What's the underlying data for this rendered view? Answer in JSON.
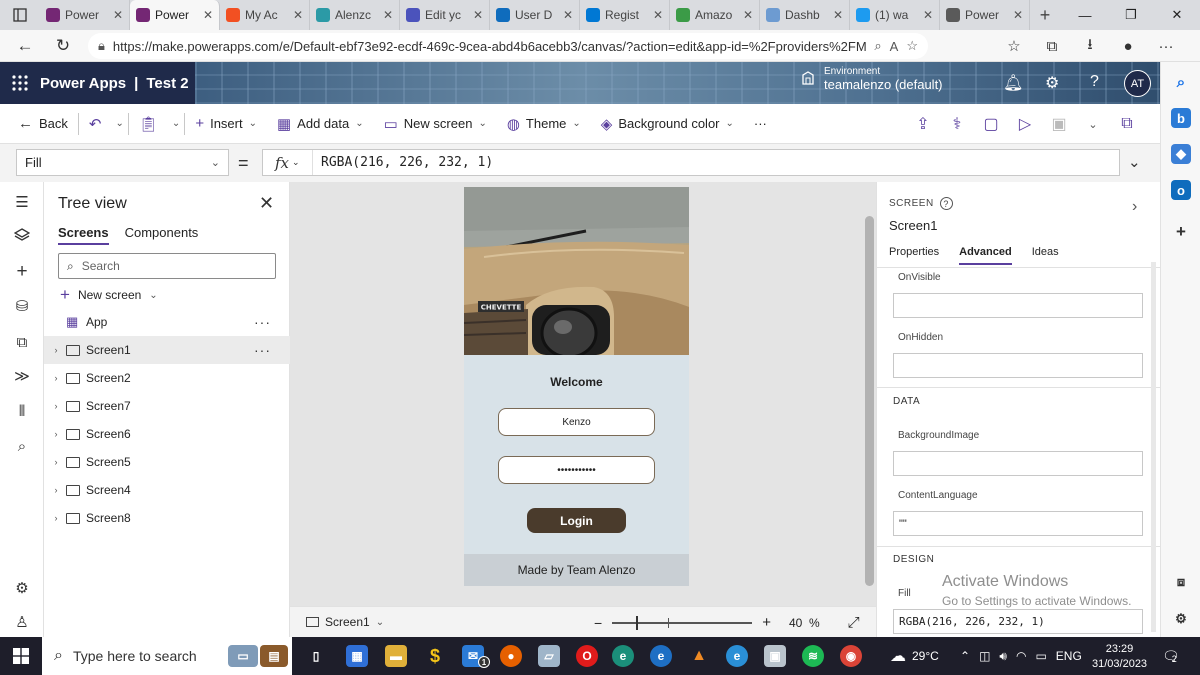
{
  "browser": {
    "tabs": [
      {
        "title": "Power",
        "color": "#742774"
      },
      {
        "title": "Power",
        "color": "#742774",
        "active": true
      },
      {
        "title": "My Ac",
        "color": "#f25022"
      },
      {
        "title": "Alenzc",
        "color": "#2b9aa6"
      },
      {
        "title": "Edit yc",
        "color": "#4b53bc"
      },
      {
        "title": "User D",
        "color": "#0f6cbd"
      },
      {
        "title": "Regist",
        "color": "#0078d4"
      },
      {
        "title": "Amazo",
        "color": "#3b9b47"
      },
      {
        "title": "Dashb",
        "color": "#6d9bd1"
      },
      {
        "title": "(1) wa",
        "color": "#1d9bf0"
      },
      {
        "title": "Power",
        "color": "#5a5a5a"
      }
    ],
    "url": "https://make.powerapps.com/e/Default-ebf73e92-ecdf-469c-9cea-abd4b6acebb3/canvas/?action=edit&app-id=%2Fproviders%2FMicroso..."
  },
  "header": {
    "product": "Power Apps",
    "divider": "|",
    "app_name": "Test 2",
    "environment_label": "Environment",
    "environment_value": "teamalenzo (default)",
    "avatar": "AT"
  },
  "commands": {
    "back": "Back",
    "insert": "Insert",
    "add_data": "Add data",
    "new_screen": "New screen",
    "theme": "Theme",
    "background_color": "Background color",
    "more": "···"
  },
  "formula": {
    "property": "Fill",
    "equals": "=",
    "fx": "fx",
    "value": "RGBA(216, 226, 232, 1)"
  },
  "tree": {
    "title": "Tree view",
    "tab_screens": "Screens",
    "tab_components": "Components",
    "search_placeholder": "Search",
    "new_screen": "New screen",
    "items": [
      {
        "label": "App"
      },
      {
        "label": "Screen1",
        "selected": true
      },
      {
        "label": "Screen2"
      },
      {
        "label": "Screen7"
      },
      {
        "label": "Screen6"
      },
      {
        "label": "Screen5"
      },
      {
        "label": "Screen4"
      },
      {
        "label": "Screen8"
      }
    ]
  },
  "app_preview": {
    "car_badge": "CHEVETTE",
    "welcome": "Welcome",
    "username": "Kenzo",
    "password": "•••••••••••",
    "login": "Login",
    "footer": "Made by Team Alenzo",
    "background": "#d8e2e8"
  },
  "canvas_bar": {
    "screen": "Screen1",
    "zoom_minus": "−",
    "zoom_plus": "+",
    "zoom_value": "40",
    "zoom_unit": "%"
  },
  "properties": {
    "kind": "SCREEN",
    "name": "Screen1",
    "tabs": {
      "properties": "Properties",
      "advanced": "Advanced",
      "ideas": "Ideas"
    },
    "on_visible_label": "OnVisible",
    "on_hidden_label": "OnHidden",
    "data_section": "DATA",
    "background_image_label": "BackgroundImage",
    "content_language_label": "ContentLanguage",
    "content_language_value": "\"\"",
    "design_section": "DESIGN",
    "fill_label": "Fill",
    "fill_value": "RGBA(216, 226, 232, 1)"
  },
  "watermark": {
    "line1": "Activate Windows",
    "line2": "Go to Settings to activate Windows."
  },
  "taskbar": {
    "search_placeholder": "Type here to search",
    "mail_badge": "1",
    "temperature": "29°C",
    "language": "ENG",
    "time": "23:29",
    "date": "31/03/2023",
    "notifications": "2"
  },
  "colors": {
    "accent": "#5a3f9e",
    "header_bg": "#1f2a4a",
    "login_btn": "#4a3b2c"
  }
}
